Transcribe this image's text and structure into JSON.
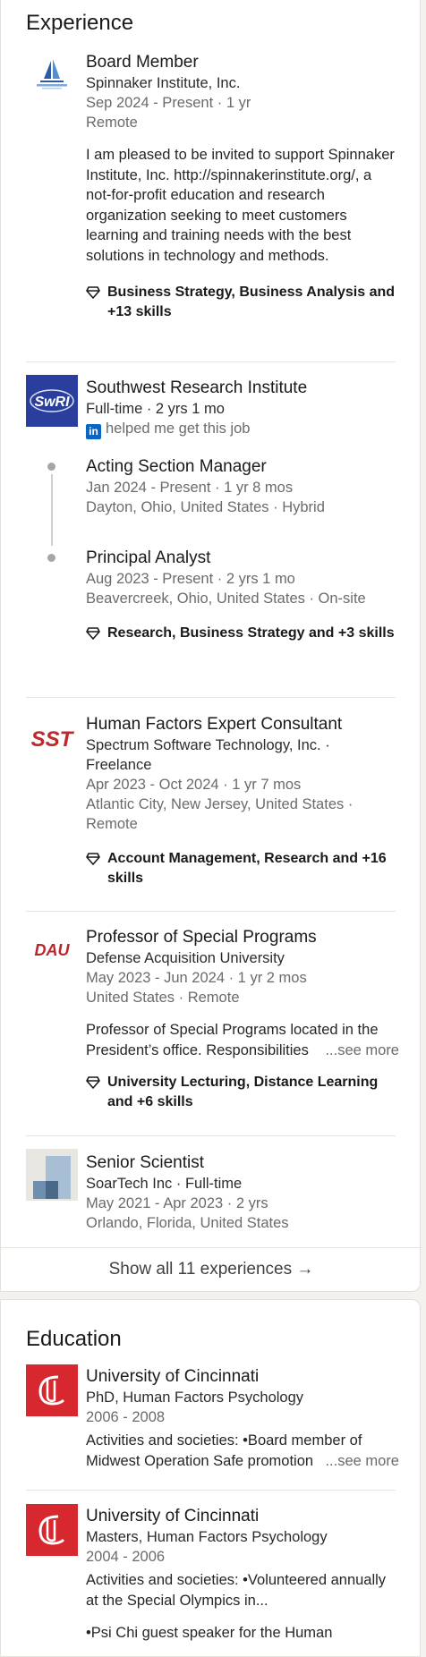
{
  "experience": {
    "section_title": "Experience",
    "items": [
      {
        "title": "Board Member",
        "company": "Spinnaker Institute, Inc.",
        "dates": "Sep 2024 - Present · 1 yr",
        "location": "Remote",
        "description": "I am pleased to be invited to support Spinnaker Institute, Inc. http://spinnakerinstitute.org/, a not-for-profit education and research organization seeking to meet customers learning and training needs with the best solutions in technology and methods.",
        "skills": "Business Strategy, Business Analysis and +13 skills"
      },
      {
        "company": "Southwest Research Institute",
        "logo_text": "SwRI",
        "tenure": "Full-time · 2 yrs 1 mo",
        "helped": "helped me get this job",
        "roles": [
          {
            "title": "Acting Section Manager",
            "dates": "Jan 2024 - Present · 1 yr 8 mos",
            "location": "Dayton, Ohio, United States · Hybrid"
          },
          {
            "title": "Principal Analyst",
            "dates": "Aug 2023 - Present · 2 yrs 1 mo",
            "location": "Beavercreek, Ohio, United States · On-site",
            "skills": "Research, Business Strategy and +3 skills"
          }
        ]
      },
      {
        "title": "Human Factors Expert Consultant",
        "logo_text": "SST",
        "company": "Spectrum Software Technology, Inc. · Freelance",
        "dates": "Apr 2023 - Oct 2024 · 1 yr 7 mos",
        "location": "Atlantic City, New Jersey, United States · Remote",
        "skills": "Account Management, Research and +16 skills"
      },
      {
        "title": "Professor of Special Programs",
        "logo_text": "DAU",
        "company": "Defense Acquisition University",
        "dates": "May 2023 - Jun 2024 · 1 yr 2 mos",
        "location": "United States · Remote",
        "description": "Professor of Special Programs located in the President’s office. Responsibilities",
        "see_more": "...see more",
        "skills": "University Lecturing, Distance Learning and +6 skills"
      },
      {
        "title": "Senior Scientist",
        "company": "SoarTech Inc · Full-time",
        "dates": "May 2021 - Apr 2023 · 2 yrs",
        "location": "Orlando, Florida, United States"
      }
    ],
    "show_all": "Show all 11 experiences →"
  },
  "education": {
    "section_title": "Education",
    "items": [
      {
        "school": "University of Cincinnati",
        "degree": "PhD, Human Factors Psychology",
        "dates": "2006 - 2008",
        "activities": "Activities and societies: •Board member of Midwest Operation Safe promotion",
        "see_more": "...see more"
      },
      {
        "school": "University of Cincinnati",
        "degree": "Masters, Human Factors Psychology",
        "dates": "2004 - 2006",
        "activities": "Activities and societies: •Volunteered annually at the Special Olympics in...",
        "extra": "•Psi Chi guest speaker for the Human"
      }
    ]
  },
  "colors": {
    "brand_blue": "#2a3f9d",
    "sst_red": "#c0282d",
    "uc_red": "#d7282f",
    "linkedin_blue": "#0a66c2"
  }
}
